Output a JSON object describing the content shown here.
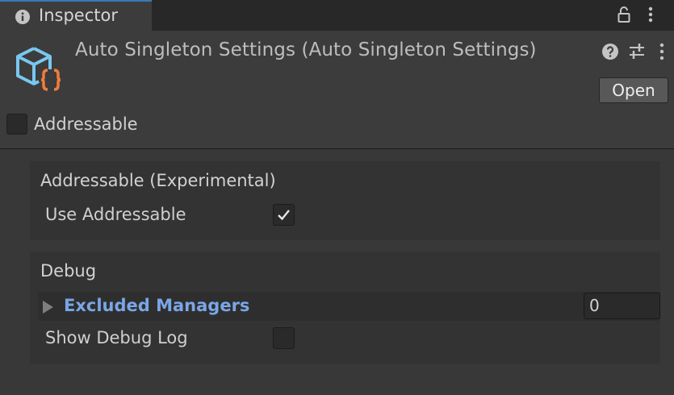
{
  "tab": {
    "title": "Inspector",
    "icon": "info-icon"
  },
  "tab_actions": {
    "lock_icon": "lock-icon",
    "menu_icon": "kebab-menu-icon"
  },
  "header": {
    "title": "Auto Singleton Settings (Auto Singleton Settings)",
    "icon": "scriptable-object-icon",
    "help_icon": "help-icon",
    "presets_icon": "sliders-icon",
    "menu_icon": "kebab-menu-icon",
    "open_label": "Open",
    "addressable_label": "Addressable",
    "addressable_checked": false
  },
  "sections": [
    {
      "title": "Addressable (Experimental)",
      "fields": [
        {
          "label": "Use Addressable",
          "type": "checkbox",
          "checked": true
        }
      ]
    },
    {
      "title": "Debug",
      "list": {
        "label": "Excluded Managers",
        "count": "0",
        "expanded": false
      },
      "fields": [
        {
          "label": "Show Debug Log",
          "type": "checkbox",
          "checked": false
        }
      ]
    }
  ],
  "colors": {
    "accent_tab": "#3a79bb",
    "list_label": "#7aa6e6",
    "script_icon_cube": "#79c7f0",
    "script_icon_braces": "#f07c3a"
  }
}
